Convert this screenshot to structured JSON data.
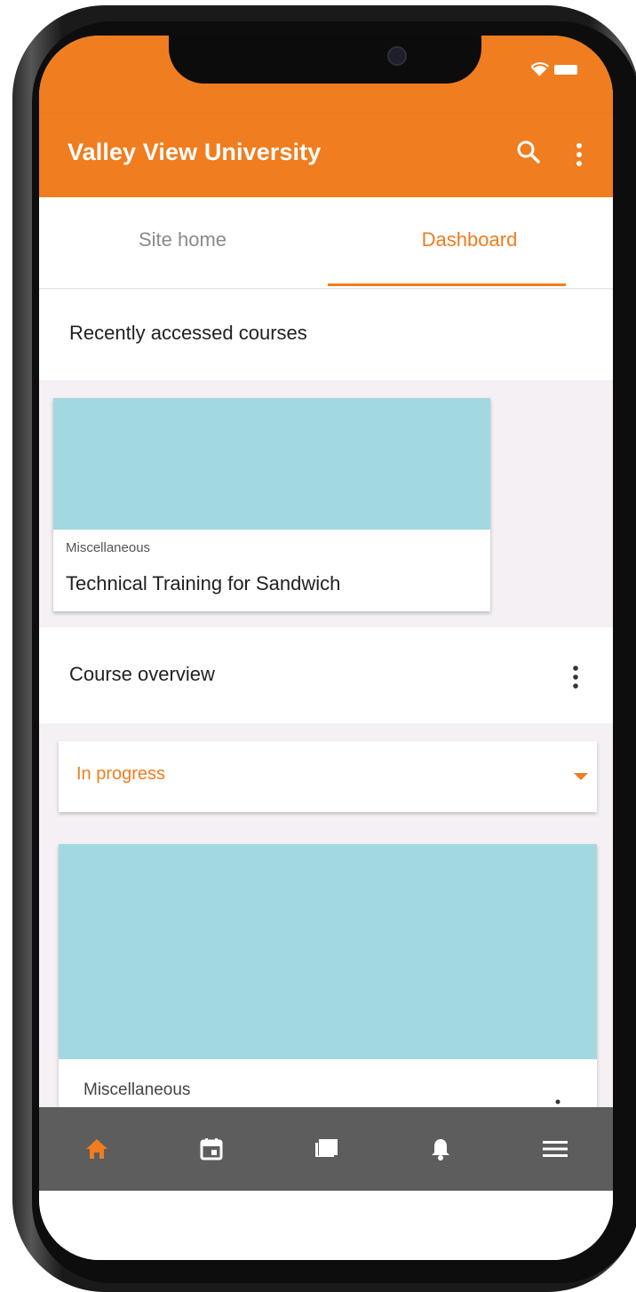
{
  "app": {
    "title": "Valley View University"
  },
  "colors": {
    "accent": "#f07d1f",
    "course_image": "#a2d9e0",
    "bottom_nav": "#5d5d5d"
  },
  "tabs": [
    {
      "label": "Site home",
      "selected": false
    },
    {
      "label": "Dashboard",
      "selected": true
    }
  ],
  "recently_accessed": {
    "title": "Recently accessed courses",
    "courses": [
      {
        "category": "Miscellaneous",
        "name": "Technical Training for Sandwich"
      }
    ]
  },
  "course_overview": {
    "title": "Course overview",
    "filter": {
      "selected": "In progress"
    },
    "courses": [
      {
        "category": "Miscellaneous"
      }
    ]
  },
  "bottom_nav": {
    "items": [
      {
        "icon": "home-icon",
        "active": true
      },
      {
        "icon": "calendar-icon",
        "active": false
      },
      {
        "icon": "messages-icon",
        "active": false
      },
      {
        "icon": "notifications-icon",
        "active": false
      },
      {
        "icon": "menu-icon",
        "active": false
      }
    ]
  }
}
